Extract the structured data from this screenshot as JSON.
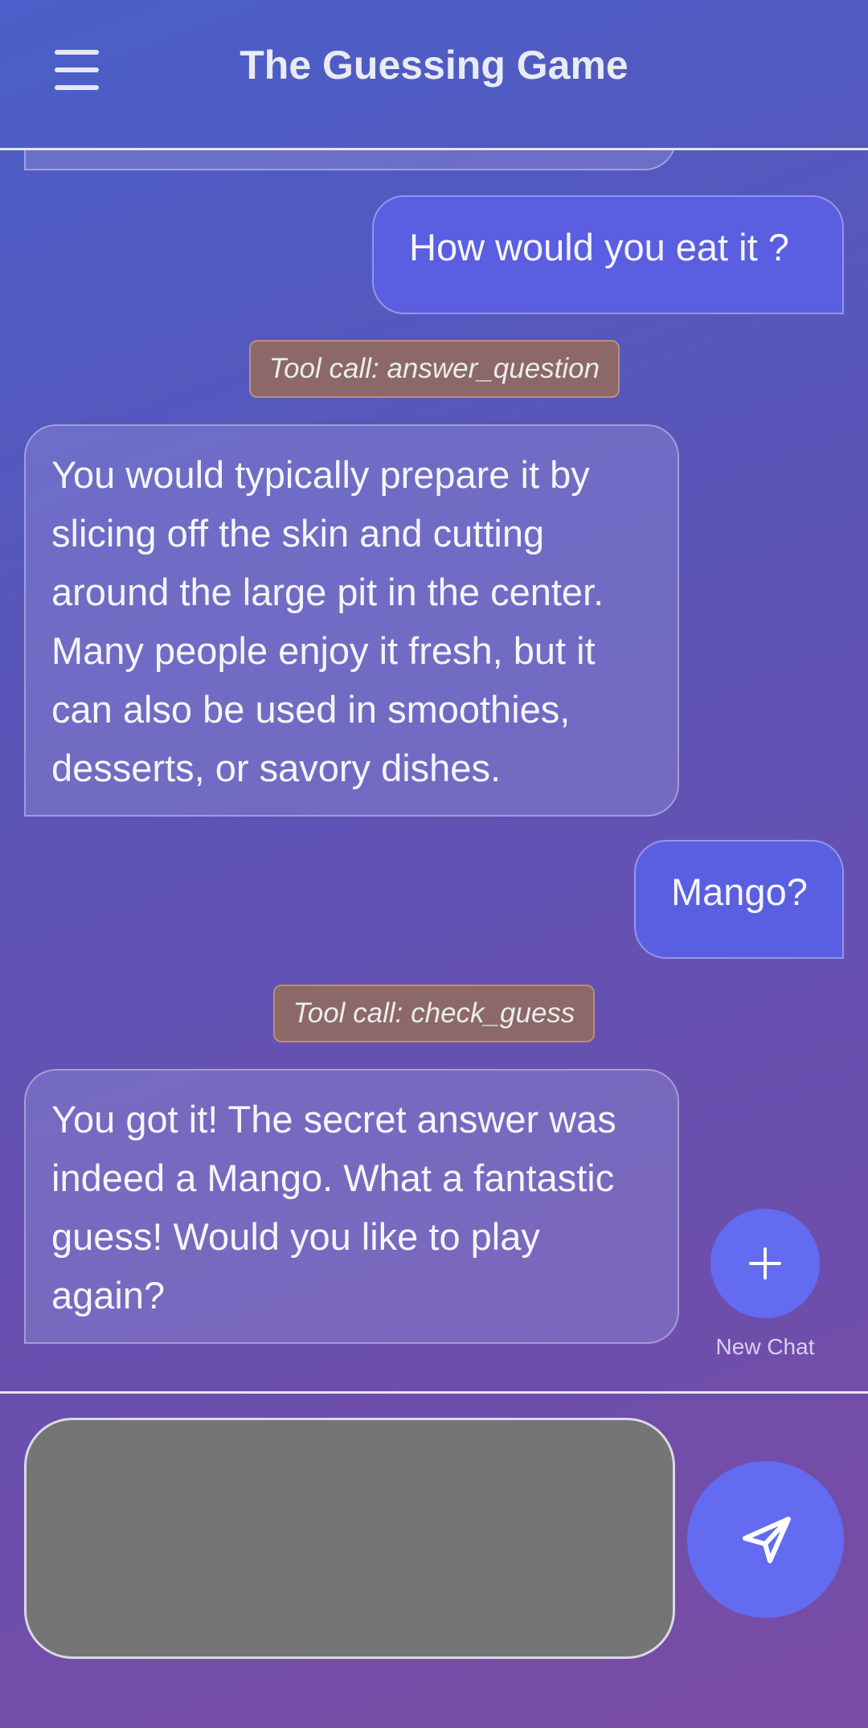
{
  "header": {
    "title": "The Guessing Game",
    "menu_icon": "hamburger-menu-icon"
  },
  "messages": [
    {
      "role": "user",
      "text": "How would you eat it ?"
    },
    {
      "role": "tool",
      "text": "Tool call: answer_question"
    },
    {
      "role": "assistant",
      "text": "You would typically prepare it by slicing off the skin and cutting around the large pit in the center. Many people enjoy it fresh, but it can also be used in smoothies, desserts, or savory dishes."
    },
    {
      "role": "user",
      "text": "Mango?"
    },
    {
      "role": "tool",
      "text": "Tool call: check_guess"
    },
    {
      "role": "assistant",
      "text": "You got it! The secret answer was indeed a Mango. What a fantastic guess! Would you like to play again?"
    }
  ],
  "new_chat": {
    "label": "New Chat",
    "icon": "plus-icon"
  },
  "composer": {
    "value": "",
    "placeholder": "",
    "send_icon": "send-icon"
  },
  "colors": {
    "accent": "#636bf0",
    "user_bubble": "#5a5ee0",
    "tool_badge": "#8c6868",
    "input_bg": "#757575"
  }
}
